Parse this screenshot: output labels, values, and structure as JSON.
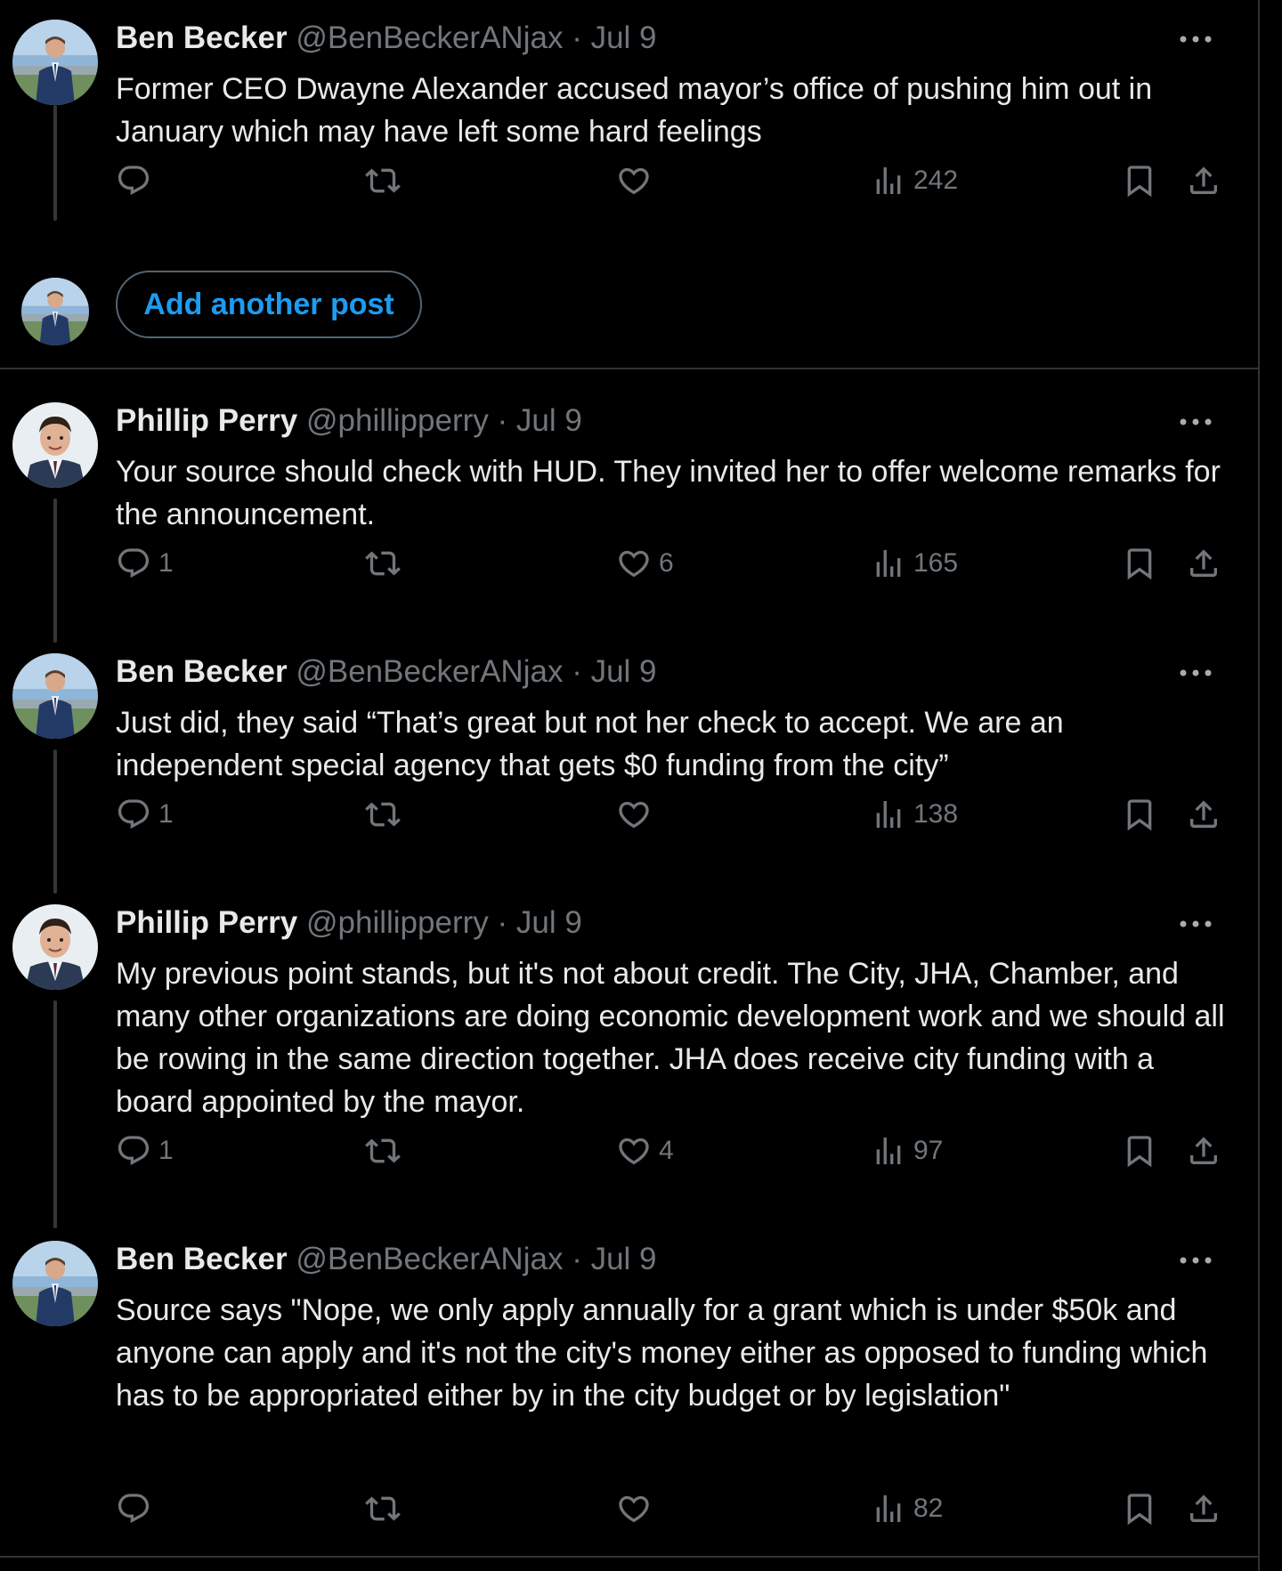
{
  "colors": {
    "background": "#000000",
    "text_primary": "#e7e9ea",
    "text_secondary": "#71767b",
    "accent": "#1d9bf0",
    "border": "#2f3336"
  },
  "compose": {
    "add_another_label": "Add another post"
  },
  "posts": [
    {
      "name": "Ben Becker",
      "handle": "@BenBeckerANjax",
      "dot": "·",
      "date": "Jul 9",
      "text": "Former CEO Dwayne Alexander accused mayor’s office of pushing him out in January which may have left some hard feelings",
      "replies": "",
      "reposts": "",
      "likes": "",
      "views": "242"
    },
    {
      "name": "Phillip Perry",
      "handle": "@phillipperry",
      "dot": "·",
      "date": "Jul 9",
      "text": "Your source should check with HUD. They invited her to offer welcome remarks for the announcement.",
      "replies": "1",
      "reposts": "",
      "likes": "6",
      "views": "165"
    },
    {
      "name": "Ben Becker",
      "handle": "@BenBeckerANjax",
      "dot": "·",
      "date": "Jul 9",
      "text": "Just did, they said “That’s great but not her check to accept. We are an independent special agency that gets $0 funding from the city”",
      "replies": "1",
      "reposts": "",
      "likes": "",
      "views": "138"
    },
    {
      "name": "Phillip Perry",
      "handle": "@phillipperry",
      "dot": "·",
      "date": "Jul 9",
      "text": "My previous point stands, but it's not about credit. The City, JHA, Chamber, and many other organizations are doing economic development work and we should all be rowing in the same direction together. JHA does receive city funding with a board appointed by the mayor.",
      "replies": "1",
      "reposts": "",
      "likes": "4",
      "views": "97"
    },
    {
      "name": "Ben Becker",
      "handle": "@BenBeckerANjax",
      "dot": "·",
      "date": "Jul 9",
      "text": "Source says \"Nope, we only apply annually for a grant which is under $50k and anyone can apply and it's not the city's money either as opposed to funding which has to be appropriated either by in the city budget or by legislation\"",
      "replies": "",
      "reposts": "",
      "likes": "",
      "views": "82"
    }
  ]
}
